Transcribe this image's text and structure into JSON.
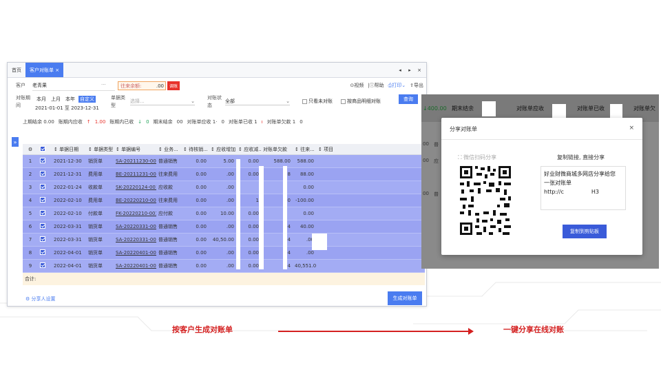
{
  "tabs": [
    "首页",
    "客户对账单 ×"
  ],
  "window_controls": [
    "◂",
    "▸",
    "×"
  ],
  "customer": {
    "label": "客户",
    "value": "老青果",
    "dots": "···"
  },
  "balance": {
    "label": "往来余额:",
    "amount": ".00",
    "adjust_label": "调账"
  },
  "toolbar": {
    "video": "视频",
    "help": "帮助",
    "print": "打印",
    "export": "导出"
  },
  "filter": {
    "period_label": "对账期间",
    "period_buttons": [
      "本月",
      "上月",
      "本年",
      "自定义"
    ],
    "date_range": "2021-01-01 至 2023-12-31",
    "doc_type_label": "单据类型",
    "doc_type_placeholder": "选择...",
    "status_label": "对账状态",
    "status_value": "全部",
    "only_unreconciled": "只看未对账",
    "by_item": "按商品明细对账",
    "query_button": "查询"
  },
  "summary": {
    "opening": "上期结余 0.00",
    "received_label": "账期内应收",
    "received_value": "1.00",
    "received2_label": "账期内已收",
    "received2_value": "0",
    "closing_label": "期末结余",
    "closing_value": "00",
    "stmt_receivable": "对账单应收 1·",
    "stmt_received_num": "0",
    "stmt_received": "对账单已收 1",
    "stmt_owing": "对账单欠款 1",
    "stmt_owing_num": "0"
  },
  "columns": [
    "",
    "",
    "单据日期",
    "单据类型",
    "单据编号",
    "业务...",
    "待核销...",
    "应收增加",
    "应收减...",
    "对账单欠款",
    "往来...",
    "项目"
  ],
  "rows": [
    {
      "no": "1",
      "date": "2021-12-30",
      "type": "销货单",
      "code": "SA-20211230-001",
      "biz": "普通销售",
      "pending": "0.00",
      "inc": "5",
      "inc2": ".00",
      "dec": "0.00",
      "owe": "588.00",
      "bal": "588.00"
    },
    {
      "no": "2",
      "date": "2021-12-31",
      "type": "费用单",
      "code": "BE-20211231-001",
      "biz": "往来费用",
      "pending": "0.00",
      "inc": "",
      "inc2": ".00",
      "dec": "0.00",
      "owe": "8",
      "bal": "88.00"
    },
    {
      "no": "3",
      "date": "2022-01-24",
      "type": "收款单",
      "code": "SK-20220124-001",
      "biz": "应收款",
      "pending": "0.00",
      "inc": "",
      "inc2": ".00",
      "dec": "",
      "owe": "",
      "bal": "0.00"
    },
    {
      "no": "4",
      "date": "2022-02-10",
      "type": "费用单",
      "code": "BE-20220210-001",
      "biz": "往来费用",
      "pending": "0.00",
      "inc": "",
      "inc2": ".00",
      "dec": "1",
      "owe": ".00",
      "bal": "-100.00"
    },
    {
      "no": "5",
      "date": "2022-02-10",
      "type": "付款单",
      "code": "FK-20220210-001",
      "biz": "应付款",
      "pending": "0.00",
      "inc": "10",
      "inc2": ".00",
      "dec": "0.00",
      "owe": "",
      "bal": "0.00"
    },
    {
      "no": "6",
      "date": "2022-03-31",
      "type": "销货单",
      "code": "SA-20220331-001",
      "biz": "普通销售",
      "pending": "0.00",
      "inc": "",
      "inc2": ".00",
      "dec": "0.00",
      "owe": "4",
      "bal": "40.00"
    },
    {
      "no": "7",
      "date": "2022-03-31",
      "type": "销货单",
      "code": "SA-20220331-003",
      "biz": "普通销售",
      "pending": "0.00",
      "inc": "40,50",
      "inc2": ".00",
      "dec": "0.00",
      "owe": "4",
      "bal": ".00"
    },
    {
      "no": "8",
      "date": "2022-04-01",
      "type": "销货单",
      "code": "SA-20220401-001",
      "biz": "普通销售",
      "pending": "0.00",
      "inc": "",
      "inc2": ".00",
      "dec": "0.00",
      "owe": "4",
      "bal": ".00"
    },
    {
      "no": "9",
      "date": "2022-04-01",
      "type": "销货单",
      "code": "SA-20220401-002",
      "biz": "普通销售",
      "pending": "0.00",
      "inc": "",
      "inc2": ".00",
      "dec": "0.00",
      "owe": "4",
      "bal": "40,551.00"
    }
  ],
  "owe_tail": [
    "",
    "",
    "",
    "",
    "",
    "",
    "0.00",
    "0.00",
    "1.00"
  ],
  "total_label": "合计:",
  "footer": {
    "share_settings": "分享人设置",
    "generate_button": "生成对账单"
  },
  "bg_panel": {
    "amount": "400.00",
    "closing": "期末结余",
    "receivable": "对账单应收",
    "received": "对账单已收",
    "owing": "对账单欠",
    "row_labels": [
      "00",
      "00",
      "00"
    ],
    "row_texts": [
      "普",
      "应",
      "普"
    ]
  },
  "modal": {
    "title": "分享对账单",
    "close": "×",
    "wechat_label": "微信扫码分享",
    "copy_title": "复制链接, 直接分享",
    "share_text_line1": "好业财微商城多网店分享给您",
    "share_text_line2": "一张对账单",
    "share_text_line3": "http://c",
    "share_text_tail": "H3",
    "copy_button": "复制到剪贴板"
  },
  "captions": {
    "left": "按客户生成对账单",
    "right": "一键分享在线对账"
  },
  "colors": {
    "accent": "#4a7cf0",
    "selected_row": "#a3acf4",
    "brand_red": "#d42020"
  }
}
